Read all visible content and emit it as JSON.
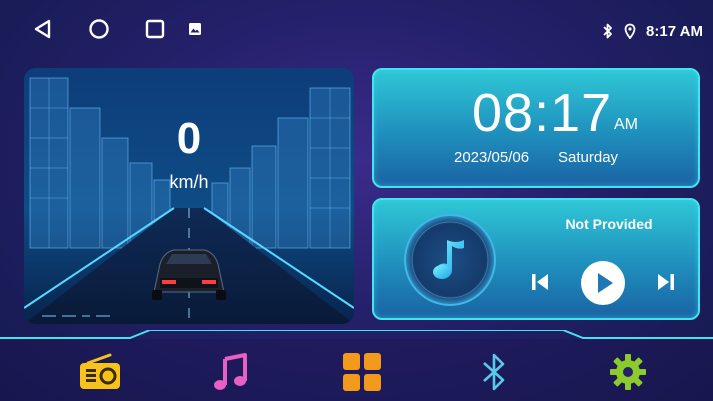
{
  "status": {
    "time": "8:17 AM",
    "bluetooth_icon": "bluetooth-icon",
    "location_icon": "location-pin-icon"
  },
  "nav": {
    "back_icon": "back-triangle-icon",
    "home_icon": "home-circle-icon",
    "recents_icon": "recents-square-icon",
    "gallery_icon": "gallery-icon"
  },
  "speed": {
    "value": "0",
    "unit": "km/h"
  },
  "clock": {
    "time": "08:17",
    "ampm": "AM",
    "date": "2023/05/06",
    "day": "Saturday"
  },
  "music": {
    "title": "Not Provided",
    "album_icon": "music-note-icon"
  },
  "dock": [
    "radio-icon",
    "music-icon",
    "apps-grid-icon",
    "bluetooth-icon",
    "settings-gear-icon"
  ],
  "colors": {
    "accent_cyan": "#43e4f0",
    "radio_yellow": "#f6c21b",
    "music_pink": "#e85fc6",
    "apps_orange": "#f39a1c",
    "bluetooth_blue": "#58c9e8",
    "settings_green": "#8dcb2c"
  }
}
